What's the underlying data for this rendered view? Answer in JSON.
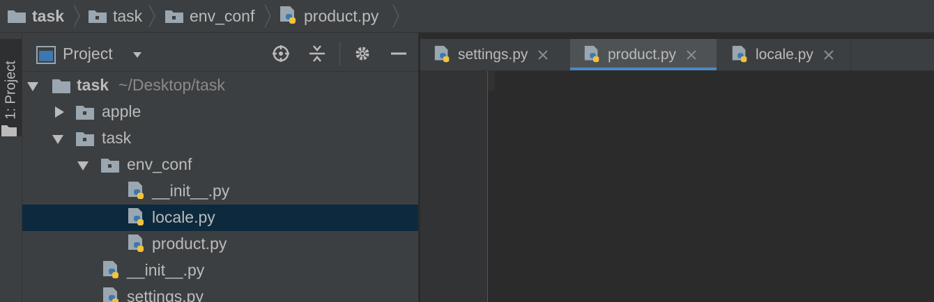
{
  "breadcrumbs": [
    {
      "label": "task",
      "icon": "folder-icon",
      "bold": true
    },
    {
      "label": "task",
      "icon": "package-folder-icon",
      "bold": false
    },
    {
      "label": "env_conf",
      "icon": "package-folder-icon",
      "bold": false
    },
    {
      "label": "product.py",
      "icon": "python-file-icon",
      "bold": false
    }
  ],
  "tool_stripe": {
    "label": "1: Project"
  },
  "project_panel": {
    "title": "Project",
    "header_icons": [
      "locate-icon",
      "collapse-all-icon",
      "gear-icon",
      "hide-icon"
    ]
  },
  "tree": [
    {
      "label": "task",
      "path": "~/Desktop/task",
      "bold": true,
      "icon": "folder-icon",
      "expanded": true,
      "level": 0
    },
    {
      "label": "apple",
      "icon": "package-folder-icon",
      "expanded": false,
      "level": 1
    },
    {
      "label": "task",
      "icon": "package-folder-icon",
      "expanded": true,
      "level": 1
    },
    {
      "label": "env_conf",
      "icon": "package-folder-icon",
      "expanded": true,
      "level": 2
    },
    {
      "label": "__init__.py",
      "icon": "python-file-icon",
      "level": 3
    },
    {
      "label": "locale.py",
      "icon": "python-file-icon",
      "level": 3,
      "selected": true
    },
    {
      "label": "product.py",
      "icon": "python-file-icon",
      "level": 3
    },
    {
      "label": "__init__.py",
      "icon": "python-file-icon",
      "level": 2
    },
    {
      "label": "settings.py",
      "icon": "python-file-icon",
      "level": 2
    }
  ],
  "tabs": [
    {
      "label": "settings.py",
      "active": false
    },
    {
      "label": "product.py",
      "active": true
    },
    {
      "label": "locale.py",
      "active": false
    }
  ],
  "colors": {
    "background": "#2b2b2b",
    "panel": "#3c3f41",
    "selection": "#0d293e",
    "tab_accent": "#4a88c7",
    "text": "#bbbbbb"
  }
}
